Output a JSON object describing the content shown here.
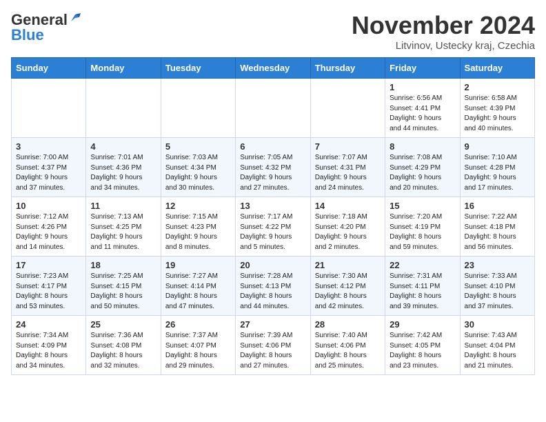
{
  "logo": {
    "general": "General",
    "blue": "Blue"
  },
  "title": "November 2024",
  "location": "Litvinov, Ustecky kraj, Czechia",
  "days_of_week": [
    "Sunday",
    "Monday",
    "Tuesday",
    "Wednesday",
    "Thursday",
    "Friday",
    "Saturday"
  ],
  "weeks": [
    [
      {
        "day": "",
        "info": ""
      },
      {
        "day": "",
        "info": ""
      },
      {
        "day": "",
        "info": ""
      },
      {
        "day": "",
        "info": ""
      },
      {
        "day": "",
        "info": ""
      },
      {
        "day": "1",
        "info": "Sunrise: 6:56 AM\nSunset: 4:41 PM\nDaylight: 9 hours\nand 44 minutes."
      },
      {
        "day": "2",
        "info": "Sunrise: 6:58 AM\nSunset: 4:39 PM\nDaylight: 9 hours\nand 40 minutes."
      }
    ],
    [
      {
        "day": "3",
        "info": "Sunrise: 7:00 AM\nSunset: 4:37 PM\nDaylight: 9 hours\nand 37 minutes."
      },
      {
        "day": "4",
        "info": "Sunrise: 7:01 AM\nSunset: 4:36 PM\nDaylight: 9 hours\nand 34 minutes."
      },
      {
        "day": "5",
        "info": "Sunrise: 7:03 AM\nSunset: 4:34 PM\nDaylight: 9 hours\nand 30 minutes."
      },
      {
        "day": "6",
        "info": "Sunrise: 7:05 AM\nSunset: 4:32 PM\nDaylight: 9 hours\nand 27 minutes."
      },
      {
        "day": "7",
        "info": "Sunrise: 7:07 AM\nSunset: 4:31 PM\nDaylight: 9 hours\nand 24 minutes."
      },
      {
        "day": "8",
        "info": "Sunrise: 7:08 AM\nSunset: 4:29 PM\nDaylight: 9 hours\nand 20 minutes."
      },
      {
        "day": "9",
        "info": "Sunrise: 7:10 AM\nSunset: 4:28 PM\nDaylight: 9 hours\nand 17 minutes."
      }
    ],
    [
      {
        "day": "10",
        "info": "Sunrise: 7:12 AM\nSunset: 4:26 PM\nDaylight: 9 hours\nand 14 minutes."
      },
      {
        "day": "11",
        "info": "Sunrise: 7:13 AM\nSunset: 4:25 PM\nDaylight: 9 hours\nand 11 minutes."
      },
      {
        "day": "12",
        "info": "Sunrise: 7:15 AM\nSunset: 4:23 PM\nDaylight: 9 hours\nand 8 minutes."
      },
      {
        "day": "13",
        "info": "Sunrise: 7:17 AM\nSunset: 4:22 PM\nDaylight: 9 hours\nand 5 minutes."
      },
      {
        "day": "14",
        "info": "Sunrise: 7:18 AM\nSunset: 4:20 PM\nDaylight: 9 hours\nand 2 minutes."
      },
      {
        "day": "15",
        "info": "Sunrise: 7:20 AM\nSunset: 4:19 PM\nDaylight: 8 hours\nand 59 minutes."
      },
      {
        "day": "16",
        "info": "Sunrise: 7:22 AM\nSunset: 4:18 PM\nDaylight: 8 hours\nand 56 minutes."
      }
    ],
    [
      {
        "day": "17",
        "info": "Sunrise: 7:23 AM\nSunset: 4:17 PM\nDaylight: 8 hours\nand 53 minutes."
      },
      {
        "day": "18",
        "info": "Sunrise: 7:25 AM\nSunset: 4:15 PM\nDaylight: 8 hours\nand 50 minutes."
      },
      {
        "day": "19",
        "info": "Sunrise: 7:27 AM\nSunset: 4:14 PM\nDaylight: 8 hours\nand 47 minutes."
      },
      {
        "day": "20",
        "info": "Sunrise: 7:28 AM\nSunset: 4:13 PM\nDaylight: 8 hours\nand 44 minutes."
      },
      {
        "day": "21",
        "info": "Sunrise: 7:30 AM\nSunset: 4:12 PM\nDaylight: 8 hours\nand 42 minutes."
      },
      {
        "day": "22",
        "info": "Sunrise: 7:31 AM\nSunset: 4:11 PM\nDaylight: 8 hours\nand 39 minutes."
      },
      {
        "day": "23",
        "info": "Sunrise: 7:33 AM\nSunset: 4:10 PM\nDaylight: 8 hours\nand 37 minutes."
      }
    ],
    [
      {
        "day": "24",
        "info": "Sunrise: 7:34 AM\nSunset: 4:09 PM\nDaylight: 8 hours\nand 34 minutes."
      },
      {
        "day": "25",
        "info": "Sunrise: 7:36 AM\nSunset: 4:08 PM\nDaylight: 8 hours\nand 32 minutes."
      },
      {
        "day": "26",
        "info": "Sunrise: 7:37 AM\nSunset: 4:07 PM\nDaylight: 8 hours\nand 29 minutes."
      },
      {
        "day": "27",
        "info": "Sunrise: 7:39 AM\nSunset: 4:06 PM\nDaylight: 8 hours\nand 27 minutes."
      },
      {
        "day": "28",
        "info": "Sunrise: 7:40 AM\nSunset: 4:06 PM\nDaylight: 8 hours\nand 25 minutes."
      },
      {
        "day": "29",
        "info": "Sunrise: 7:42 AM\nSunset: 4:05 PM\nDaylight: 8 hours\nand 23 minutes."
      },
      {
        "day": "30",
        "info": "Sunrise: 7:43 AM\nSunset: 4:04 PM\nDaylight: 8 hours\nand 21 minutes."
      }
    ]
  ]
}
